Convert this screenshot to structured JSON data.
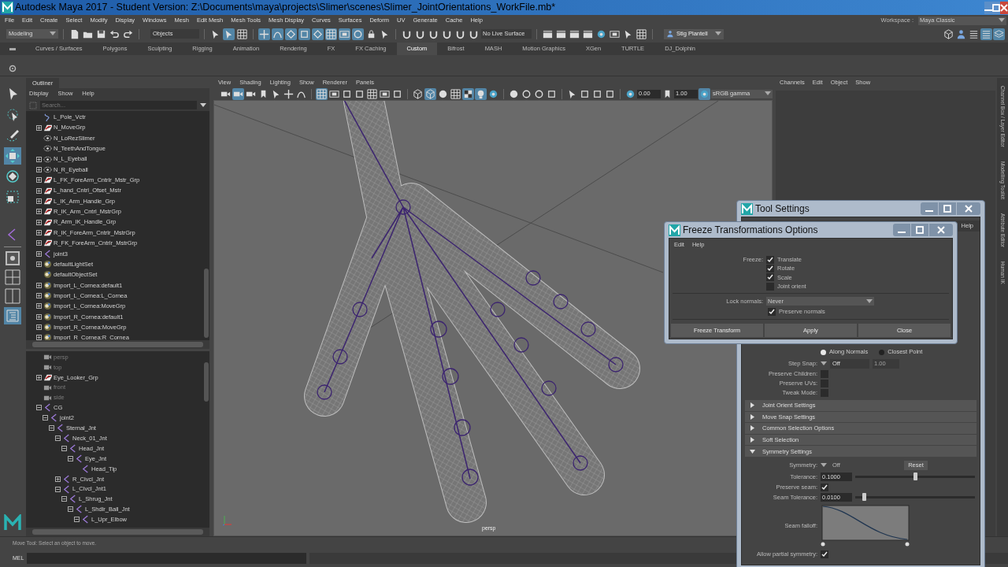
{
  "window": {
    "title": "Autodesk Maya 2017 - Student Version: Z:\\Documents\\maya\\projects\\Slimer\\scenes\\Slimer_JointOrientations_WorkFile.mb*"
  },
  "menu_bar": [
    "File",
    "Edit",
    "Create",
    "Select",
    "Modify",
    "Display",
    "Windows",
    "Mesh",
    "Edit Mesh",
    "Mesh Tools",
    "Mesh Display",
    "Curves",
    "Surfaces",
    "Deform",
    "UV",
    "Generate",
    "Cache",
    "Help"
  ],
  "workspace": {
    "label": "Workspace :",
    "value": "Maya Classic"
  },
  "status_line": {
    "menu_set": "Modeling",
    "selection_mode": "Objects",
    "live_surface": "No Live Surface",
    "account": "Stig Plantell"
  },
  "shelf_tabs": [
    {
      "label": "Curves / Surfaces",
      "selected": false
    },
    {
      "label": "Polygons",
      "selected": false
    },
    {
      "label": "Sculpting",
      "selected": false
    },
    {
      "label": "Rigging",
      "selected": false
    },
    {
      "label": "Animation",
      "selected": false
    },
    {
      "label": "Rendering",
      "selected": false
    },
    {
      "label": "FX",
      "selected": false
    },
    {
      "label": "FX Caching",
      "selected": false
    },
    {
      "label": "Custom",
      "selected": true
    },
    {
      "label": "Bifrost",
      "selected": false
    },
    {
      "label": "MASH",
      "selected": false
    },
    {
      "label": "Motion Graphics",
      "selected": false
    },
    {
      "label": "XGen",
      "selected": false
    },
    {
      "label": "TURTLE",
      "selected": false
    },
    {
      "label": "DJ_Dolphin",
      "selected": false
    }
  ],
  "outliner": {
    "title": "Outliner",
    "menu": [
      "Display",
      "Show",
      "Help"
    ],
    "search": {
      "placeholder": "Search..."
    },
    "upper_items": [
      {
        "label": "L_Pole_Vctr",
        "kind": "curve"
      },
      {
        "label": "N_MoveGrp",
        "kind": "group",
        "expanded": false
      },
      {
        "label": "N_LoRezSlimer",
        "kind": "mesh"
      },
      {
        "label": "N_TeethAndTongue",
        "kind": "mesh"
      },
      {
        "label": "N_L_Eyeball",
        "kind": "mesh",
        "expanded": false
      },
      {
        "label": "N_R_Eyeball",
        "kind": "mesh",
        "expanded": false
      },
      {
        "label": "L_FK_ForeArm_Cntrlr_Mstr_Grp",
        "kind": "group",
        "expanded": false
      },
      {
        "label": "L_hand_Cntrl_Ofset_Mstr",
        "kind": "group",
        "expanded": false
      },
      {
        "label": "L_IK_Arm_Handle_Grp",
        "kind": "group",
        "expanded": false
      },
      {
        "label": "R_IK_Arm_Cntrl_MstrGrp",
        "kind": "group",
        "expanded": false
      },
      {
        "label": "R_Arm_IK_Handle_Grp",
        "kind": "group",
        "expanded": false
      },
      {
        "label": "R_IK_ForeArm_Cntrlr_MstrGrp",
        "kind": "group",
        "expanded": false
      },
      {
        "label": "R_FK_ForeArm_Cntrlr_MstrGrp",
        "kind": "group",
        "expanded": false
      },
      {
        "label": "joint3",
        "kind": "joint",
        "expanded": false
      },
      {
        "label": "defaultLightSet",
        "kind": "set",
        "expanded": false
      },
      {
        "label": "defaultObjectSet",
        "kind": "set"
      },
      {
        "label": "Import_L_Cornea:default1",
        "kind": "set",
        "expanded": false
      },
      {
        "label": "Import_L_Cornea:L_Cornea",
        "kind": "set",
        "expanded": false
      },
      {
        "label": "Import_L_Cornea:MoveGrp",
        "kind": "set",
        "expanded": false
      },
      {
        "label": "Import_R_Cornea:default1",
        "kind": "set",
        "expanded": false
      },
      {
        "label": "Import_R_Cornea:MoveGrp",
        "kind": "set",
        "expanded": false
      },
      {
        "label": "Import_R_Cornea:R_Cornea",
        "kind": "set",
        "expanded": false
      }
    ],
    "lower_items": [
      {
        "label": "persp",
        "kind": "camera",
        "dimmed": true
      },
      {
        "label": "top",
        "kind": "camera",
        "dimmed": true
      },
      {
        "label": "Eye_Looker_Grp",
        "kind": "group",
        "expanded": false,
        "dimmed": false
      },
      {
        "label": "front",
        "kind": "camera",
        "dimmed": true
      },
      {
        "label": "side",
        "kind": "camera",
        "dimmed": true
      },
      {
        "label": "CG",
        "kind": "joint",
        "expanded": true,
        "dimmed": false,
        "children": [
          {
            "label": "joint2",
            "kind": "joint",
            "expanded": true,
            "dimmed": false,
            "children": [
              {
                "label": "Sternal_Jnt",
                "kind": "joint",
                "expanded": true,
                "dimmed": false,
                "children": [
                  {
                    "label": "Neck_01_Jnt",
                    "kind": "joint",
                    "expanded": true,
                    "dimmed": false,
                    "children": [
                      {
                        "label": "Head_Jnt",
                        "kind": "joint",
                        "expanded": true,
                        "dimmed": false,
                        "children": [
                          {
                            "label": "Eye_Jnt",
                            "kind": "joint",
                            "expanded": true,
                            "dimmed": false,
                            "children": [
                              {
                                "label": "Head_Tip",
                                "kind": "joint",
                                "dimmed": false
                              }
                            ]
                          }
                        ]
                      }
                    ]
                  },
                  {
                    "label": "R_Clvcl_Jnt",
                    "kind": "joint",
                    "expanded": false,
                    "dimmed": false
                  },
                  {
                    "label": "L_Clvcl_Jnt1",
                    "kind": "joint",
                    "expanded": true,
                    "dimmed": false,
                    "children": [
                      {
                        "label": "L_Shrug_Jnt",
                        "kind": "joint",
                        "expanded": true,
                        "dimmed": false,
                        "children": [
                          {
                            "label": "L_Shdlr_Ball_Jnt",
                            "kind": "joint",
                            "expanded": true,
                            "dimmed": false,
                            "children": [
                              {
                                "label": "L_Upr_Elbow",
                                "kind": "joint",
                                "expanded": true,
                                "dimmed": false
                              }
                            ]
                          }
                        ]
                      }
                    ]
                  }
                ]
              }
            ]
          }
        ]
      }
    ]
  },
  "viewport": {
    "menu": [
      "View",
      "Shading",
      "Lighting",
      "Show",
      "Renderer",
      "Panels"
    ],
    "exposure": "0.00",
    "gamma": "1.00",
    "color_space": "sRGB gamma",
    "camera": "persp"
  },
  "channel_box": {
    "menu": [
      "Channels",
      "Edit",
      "Object",
      "Show"
    ]
  },
  "side_tabs": [
    "Channel Box / Layer Editor",
    "Modelling Toolkit",
    "Attribute Editor",
    "Human IK"
  ],
  "tool_settings": {
    "title": "Tool Settings",
    "menu": [
      "Help"
    ],
    "radios": [
      {
        "label": "Along Normals",
        "selected": true
      },
      {
        "label": "Closest Point",
        "selected": false
      }
    ],
    "step_snap": {
      "label": "Step Snap:",
      "value": "Off",
      "amount": "1.00"
    },
    "checks": [
      {
        "label": "Preserve Children:",
        "checked": false
      },
      {
        "label": "Preserve UVs:",
        "checked": false
      },
      {
        "label": "Tweak Mode:",
        "checked": false
      }
    ],
    "sections": [
      {
        "label": "Joint Orient Settings",
        "expanded": false
      },
      {
        "label": "Move Snap Settings",
        "expanded": false
      },
      {
        "label": "Common Selection Options",
        "expanded": false
      },
      {
        "label": "Soft Selection",
        "expanded": false
      },
      {
        "label": "Symmetry Settings",
        "expanded": true
      }
    ],
    "symmetry": {
      "label": "Symmetry:",
      "value": "Off",
      "reset": "Reset"
    },
    "tolerance": {
      "label": "Tolerance:",
      "value": "0.1000",
      "level": 0.5
    },
    "preserve_seam": {
      "label": "Preserve seam:",
      "checked": true
    },
    "seam_tolerance": {
      "label": "Seam Tolerance:",
      "value": "0.0100",
      "level": 0.07
    },
    "seam_falloff": {
      "label": "Seam falloff:"
    },
    "partial_symmetry": {
      "label": "Allow partial symmetry:",
      "checked": true
    }
  },
  "freeze_dialog": {
    "title": "Freeze Transformations Options",
    "menu": [
      "Edit",
      "Help"
    ],
    "freeze_label": "Freeze:",
    "options": [
      {
        "label": "Translate",
        "checked": true
      },
      {
        "label": "Rotate",
        "checked": true
      },
      {
        "label": "Scale",
        "checked": true
      },
      {
        "label": "Joint orient",
        "checked": false
      }
    ],
    "lock_normals": {
      "label": "Lock normals:",
      "value": "Never"
    },
    "preserve_normals": {
      "label": "Preserve normals",
      "checked": true
    },
    "buttons": [
      "Freeze Transform",
      "Apply",
      "Close"
    ]
  },
  "help_line": "Move Tool: Select an object to move.",
  "command_line": {
    "label": "MEL"
  }
}
